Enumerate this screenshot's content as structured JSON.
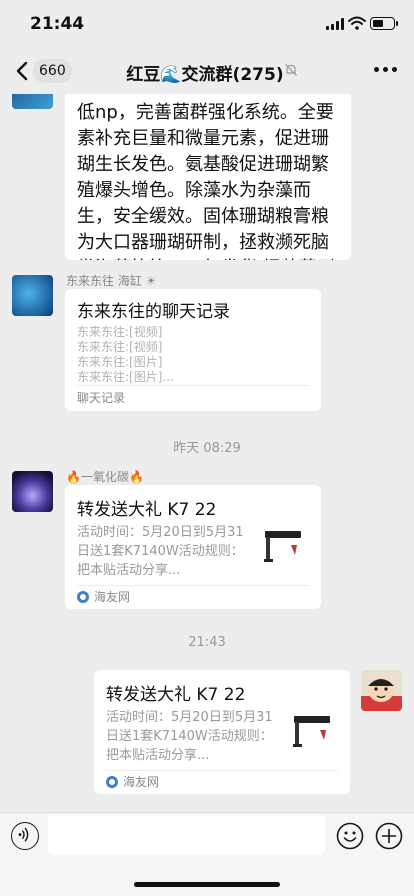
{
  "status_bar": {
    "time": "21:44"
  },
  "nav": {
    "back_icon": "chevron-left-icon",
    "unread_count": "660",
    "title": "红豆🌊交流群(275)",
    "mute_icon": "bell-slash-icon",
    "more_icon": "ellipsis-icon"
  },
  "messages": {
    "partial_text": {
      "text": "全菌混合菌处理水体有机物，降低np，完善菌群强化系统。全要素补充巨量和微量元素，促进珊瑚生长发色。氨基酸促进珊瑚繁殖爆头增色。除藻水为杂藻而生，安全缓效。固体珊瑚粮膏粮为大口器珊瑚研制，拯救濒死脑类海葵等等。下午发货,桶装菌到货了😁"
    },
    "chat_record": {
      "sender": "东来东往 海缸 ☀",
      "title": "东来东往的聊天记录",
      "lines": [
        "东来东往:[视频]",
        "东来东往:[视频]",
        "东来东往:[图片]",
        "东来东往:[图片]..."
      ],
      "footer": "聊天记录"
    },
    "timestamp_1": "昨天 08:29",
    "link_1": {
      "sender": "🔥一氧化碳🔥",
      "title": "转发送大礼 K7 22",
      "description": "活动时间：5月20日到5月31日送1套K7140W活动规则：把本贴活动分享...",
      "source": "海友网"
    },
    "timestamp_2": "21:43",
    "link_2": {
      "title": "转发送大礼 K7 22",
      "description": "活动时间：5月20日到5月31日送1套K7140W活动规则：把本贴活动分享...",
      "source": "海友网"
    }
  },
  "input_bar": {
    "voice_icon": "voice-icon",
    "emoji_icon": "emoji-icon",
    "plus_icon": "plus-icon"
  }
}
